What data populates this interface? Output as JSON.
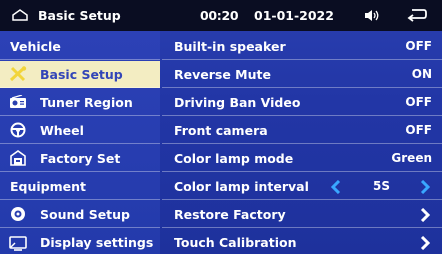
{
  "topbar": {
    "title": "Basic Setup",
    "time": "00:20",
    "date": "01-01-2022"
  },
  "sidebar": {
    "sections": [
      {
        "label": "Vehicle"
      },
      {
        "label": "Equipment"
      }
    ],
    "items": [
      {
        "label": "Basic Setup",
        "icon": "wrench-screwdriver-icon",
        "selected": true
      },
      {
        "label": "Tuner Region",
        "icon": "radio-icon"
      },
      {
        "label": "Wheel",
        "icon": "steering-wheel-icon"
      },
      {
        "label": "Factory Set",
        "icon": "factory-icon"
      },
      {
        "label": "Sound Setup",
        "icon": "speaker-icon"
      },
      {
        "label": "Display settings",
        "icon": "display-icon"
      }
    ]
  },
  "settings": [
    {
      "label": "Built-in speaker",
      "value": "OFF"
    },
    {
      "label": "Reverse Mute",
      "value": "ON"
    },
    {
      "label": "Driving Ban Video",
      "value": "OFF"
    },
    {
      "label": "Front camera",
      "value": "OFF"
    },
    {
      "label": "Color lamp mode",
      "value": "Green"
    },
    {
      "label": "Color lamp interval",
      "value": "5S"
    },
    {
      "label": "Restore Factory"
    },
    {
      "label": "Touch Calibration"
    }
  ],
  "colors": {
    "background": "#2236a6",
    "topbar": "#0a0d22",
    "selected": "#f3edc2",
    "accent_arrow": "#39a7ff"
  }
}
